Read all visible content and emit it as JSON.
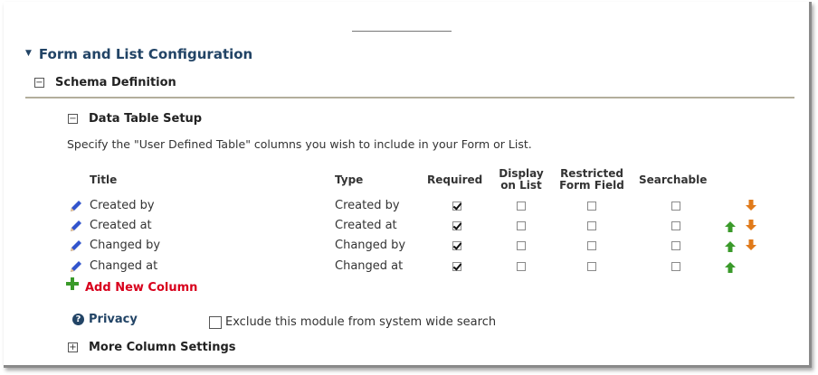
{
  "section": {
    "title": "Form and List Configuration"
  },
  "schema": {
    "label": "Schema Definition"
  },
  "data_table": {
    "label": "Data Table Setup",
    "description": "Specify the \"User Defined Table\" columns you wish to include in your Form or List."
  },
  "columns_header": {
    "title": "Title",
    "type": "Type",
    "required": "Required",
    "display_1": "Display",
    "display_2": "on List",
    "restricted_1": "Restricted",
    "restricted_2": "Form Field",
    "searchable": "Searchable"
  },
  "rows": [
    {
      "title": "Created by",
      "type": "Created by",
      "required": true,
      "display_on_list": false,
      "restricted": false,
      "searchable": false,
      "move_up": false,
      "move_down": true
    },
    {
      "title": "Created at",
      "type": "Created at",
      "required": true,
      "display_on_list": false,
      "restricted": false,
      "searchable": false,
      "move_up": true,
      "move_down": true
    },
    {
      "title": "Changed by",
      "type": "Changed by",
      "required": true,
      "display_on_list": false,
      "restricted": false,
      "searchable": false,
      "move_up": true,
      "move_down": true
    },
    {
      "title": "Changed at",
      "type": "Changed at",
      "required": true,
      "display_on_list": false,
      "restricted": false,
      "searchable": false,
      "move_up": true,
      "move_down": false
    }
  ],
  "add_column": {
    "label": "Add New Column"
  },
  "privacy": {
    "label": "Privacy",
    "exclude_label": "Exclude this module from system wide search",
    "exclude_checked": false
  },
  "more_settings": {
    "label": "More Column Settings"
  },
  "colors": {
    "heading": "#224466",
    "add_link": "#d8001c",
    "up_arrow": "#3a9a2a",
    "down_arrow": "#e07a1a",
    "pencil": "#3355cc"
  },
  "icons": {
    "edit": "pencil-icon",
    "up": "arrow-up-icon",
    "down": "arrow-down-icon",
    "add": "plus-icon",
    "info": "info-icon"
  }
}
